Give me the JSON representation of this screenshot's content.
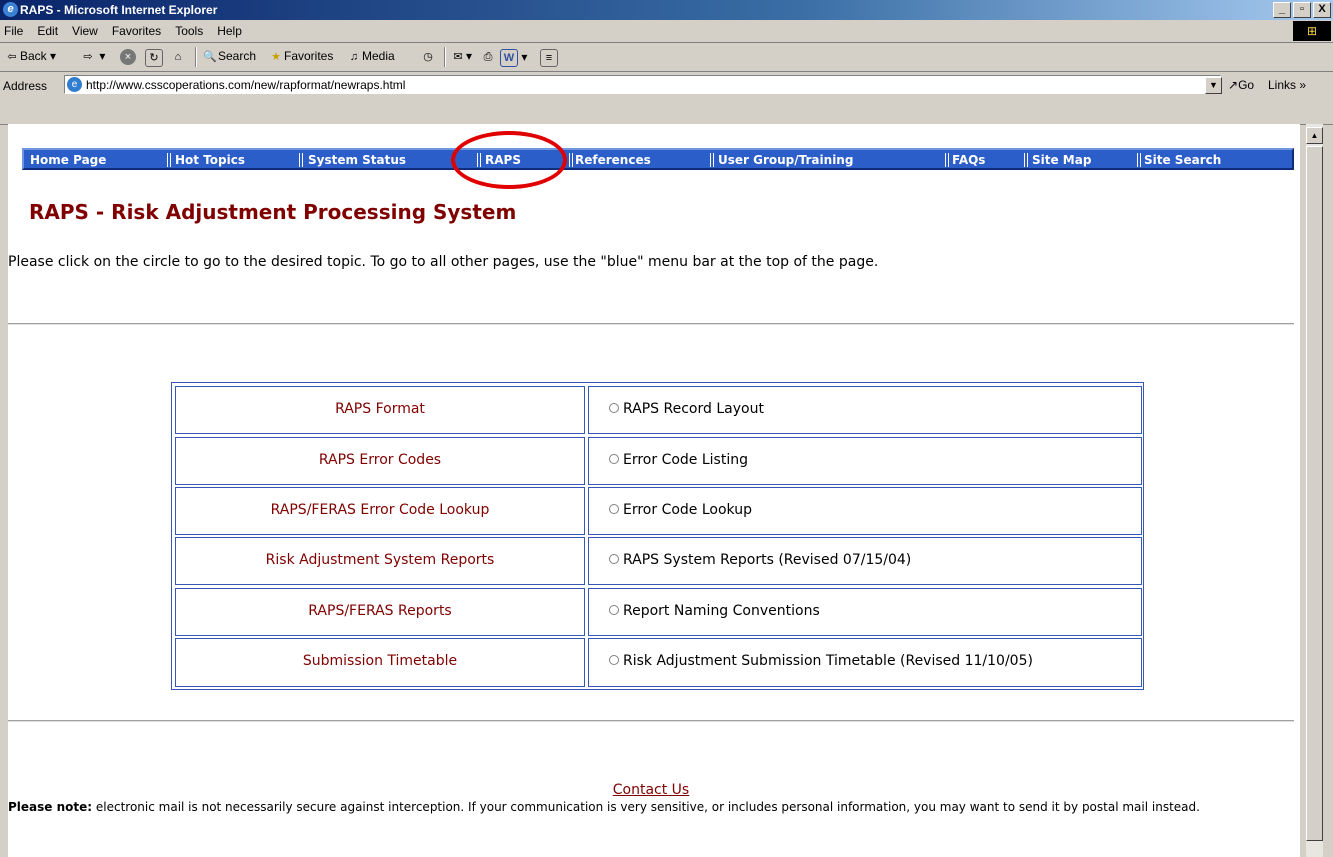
{
  "window": {
    "title": "RAPS - Microsoft Internet Explorer",
    "buttons": [
      "_",
      "▫",
      "X"
    ]
  },
  "menu": [
    "File",
    "Edit",
    "View",
    "Favorites",
    "Tools",
    "Help"
  ],
  "toolbar": {
    "back": "Back",
    "search": "Search",
    "favorites": "Favorites",
    "media": "Media"
  },
  "address": {
    "label": "Address",
    "url": "http://www.csscoperations.com/new/rapformat/newraps.html",
    "go": "Go",
    "links": "Links"
  },
  "nav": [
    "Home Page",
    "Hot Topics",
    "System Status",
    "RAPS",
    "References",
    "User Group/Training",
    "FAQs",
    "Site Map",
    "Site Search"
  ],
  "page": {
    "heading": "RAPS - Risk Adjustment Processing System",
    "intro": "Please click on the circle to go to the desired topic. To go to all other pages, use the \"blue\" menu bar at the top of the page.",
    "rows": [
      {
        "topic": "RAPS Format",
        "link": "RAPS Record Layout"
      },
      {
        "topic": "RAPS Error Codes",
        "link": " Error Code Listing"
      },
      {
        "topic": "RAPS/FERAS Error Code Lookup",
        "link": "Error Code Lookup"
      },
      {
        "topic": "Risk Adjustment System Reports",
        "link": "RAPS System Reports (Revised 07/15/04)"
      },
      {
        "topic": "RAPS/FERAS Reports",
        "link": " Report Naming Conventions"
      },
      {
        "topic": "Submission Timetable",
        "link": " Risk Adjustment Submission Timetable (Revised 11/10/05)"
      }
    ],
    "contact": "Contact Us",
    "note_bold": "Please note:",
    "note_text": " electronic mail is not necessarily secure against interception. If your communication is very sensitive, or includes personal information, you may want to send it by postal mail instead."
  }
}
